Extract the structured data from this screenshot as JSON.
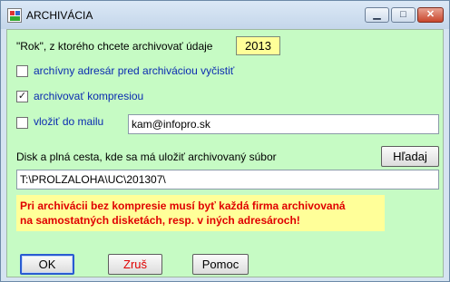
{
  "window": {
    "title": "ARCHIVÁCIA",
    "minimize_label": "▁",
    "maximize_label": "□",
    "close_label": "✕"
  },
  "form": {
    "year_prompt": "\"Rok\", z ktorého chcete archivovať údaje",
    "year_value": "2013",
    "clear_dir_label": "archívny adresár pred archiváciou vyčistiť",
    "clear_dir_checked": false,
    "compress_label": "archivovať kompresiou",
    "compress_checked": true,
    "email_label": "vložiť do mailu",
    "email_checked": false,
    "email_value": "kam@infopro.sk",
    "path_label": "Disk a plná cesta, kde sa má uložiť archivovaný súbor",
    "search_button": "Hľadaj",
    "path_value": "T:\\PROLZALOHA\\UC\\201307\\",
    "warning_line1": "Pri archivácii bez kompresie musí byť každá firma archivovaná",
    "warning_line2": "na samostatných disketách, resp. v iných adresároch!"
  },
  "buttons": {
    "ok": "OK",
    "cancel": "Zruš",
    "help": "Pomoc"
  },
  "colors": {
    "client_bg": "#c6fbc4",
    "highlight_bg": "#ffff99",
    "warning_text": "#e00000",
    "option_text": "#0b2bb0"
  }
}
